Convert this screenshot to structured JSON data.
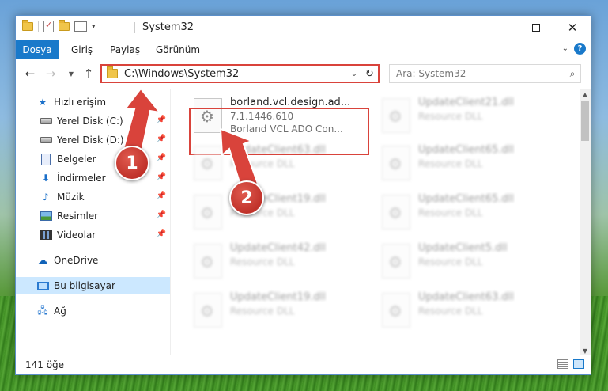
{
  "window": {
    "title": "System32"
  },
  "ribbon": {
    "tabs": [
      "Dosya",
      "Giriş",
      "Paylaş",
      "Görünüm"
    ],
    "file_color": "#1979ca"
  },
  "address": {
    "path": "C:\\Windows\\System32"
  },
  "search": {
    "placeholder": "Ara: System32"
  },
  "sidebar": {
    "quick_access": "Hızlı erişim",
    "items": [
      {
        "label": "Yerel Disk (C:)",
        "icon": "drive-icon",
        "pinned": true
      },
      {
        "label": "Yerel Disk (D:)",
        "icon": "drive-icon",
        "pinned": true
      },
      {
        "label": "Belgeler",
        "icon": "documents-icon",
        "pinned": true
      },
      {
        "label": "İndirmeler",
        "icon": "downloads-icon",
        "pinned": true
      },
      {
        "label": "Müzik",
        "icon": "music-icon",
        "pinned": true
      },
      {
        "label": "Resimler",
        "icon": "pictures-icon",
        "pinned": true
      },
      {
        "label": "Videolar",
        "icon": "videos-icon",
        "pinned": true
      }
    ],
    "onedrive": "OneDrive",
    "this_pc": "Bu bilgisayar",
    "network": "Ağ"
  },
  "files": {
    "highlighted": {
      "name": "borland.vcl.design.ad...",
      "version": "7.1.1446.610",
      "description": "Borland VCL ADO Con..."
    },
    "others": [
      {
        "name": "UpdateClient21.dll",
        "type": "Resource DLL"
      },
      {
        "name": "UpdateClient63.dll",
        "type": "Resource DLL"
      },
      {
        "name": "UpdateClient65.dll",
        "type": "Resource DLL"
      },
      {
        "name": "UpdateClient19.dll",
        "type": "Resource DLL"
      },
      {
        "name": "UpdateClient65.dll",
        "type": "Resource DLL"
      },
      {
        "name": "UpdateClient42.dll",
        "type": "Resource DLL"
      },
      {
        "name": "UpdateClient5.dll",
        "type": "Resource DLL"
      },
      {
        "name": "UpdateClient19.dll",
        "type": "Resource DLL"
      },
      {
        "name": "UpdateClient63.dll",
        "type": "Resource DLL"
      }
    ]
  },
  "status": {
    "count": "141 öğe"
  },
  "annotations": {
    "badge1": "1",
    "badge2": "2",
    "color": "#d9433b"
  }
}
